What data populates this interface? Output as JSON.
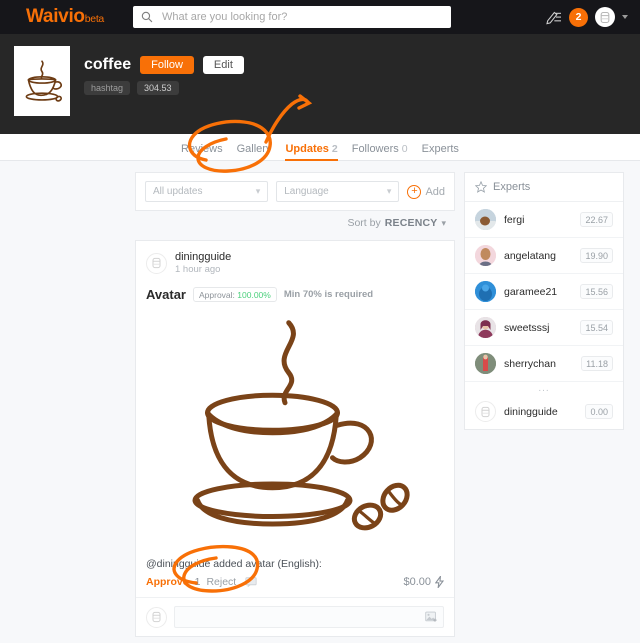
{
  "topnav": {
    "brand": "Waivio",
    "brand_suffix": "beta",
    "search_placeholder": "What are you looking for?",
    "search_value": "",
    "notification_count": "2",
    "icons": {
      "search": "search-icon",
      "pen": "pen-edit-icon",
      "avatar": "user-avatar-icon",
      "caret": "chevron-down-icon"
    }
  },
  "profile": {
    "name": "coffee",
    "follow_label": "Follow",
    "edit_label": "Edit",
    "type_chip": "hashtag",
    "score_chip": "304.53"
  },
  "tabs": [
    {
      "label": "Reviews",
      "count": "",
      "active": false
    },
    {
      "label": "Gallery",
      "count": "",
      "active": false
    },
    {
      "label": "Updates",
      "count": "2",
      "active": true
    },
    {
      "label": "Followers",
      "count": "0",
      "active": false
    },
    {
      "label": "Experts",
      "count": "",
      "active": false
    }
  ],
  "filters": {
    "updates_select": "All updates",
    "language_select": "Language",
    "add_label": "Add",
    "sort_label": "Sort by",
    "sort_value": "RECENCY"
  },
  "post": {
    "author": "diningguide",
    "time": "1 hour ago",
    "field_title": "Avatar",
    "approval_prefix": "Approval:",
    "approval_value": "100.00%",
    "approval_note": "Min 70% is required",
    "caption": "@diningguide added avatar (English):",
    "approve_label": "Approve",
    "approve_count": "1",
    "reject_label": "Reject",
    "payout": "$0.00",
    "comment_placeholder": ""
  },
  "experts_panel": {
    "title": "Experts",
    "items": [
      {
        "name": "fergi",
        "score": "22.67",
        "avatar_color": "#b7c7d4"
      },
      {
        "name": "angelatang",
        "score": "19.90",
        "avatar_color": "#f2d4da"
      },
      {
        "name": "garamee21",
        "score": "15.56",
        "avatar_color": "#2f8fd8"
      },
      {
        "name": "sweetsssj",
        "score": "15.54",
        "avatar_color": "#d9b9c9"
      },
      {
        "name": "sherrychan",
        "score": "11.18",
        "avatar_color": "#8a9b86"
      },
      {
        "name": "diningguide",
        "score": "0.00",
        "avatar_color": "#ffffff"
      }
    ],
    "ellipsis": "..."
  },
  "colors": {
    "accent": "#f87007",
    "nav_bg": "#16161a",
    "profile_bg": "#272727",
    "page_bg": "#f7f8fa",
    "approval_green": "#4cd07d",
    "coffee_brown": "#7a4318"
  }
}
